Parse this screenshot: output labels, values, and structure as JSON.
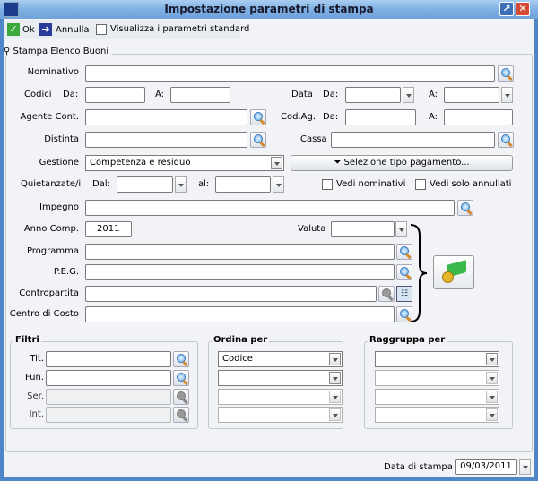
{
  "window": {
    "title": "Impostazione parametri di stampa"
  },
  "toolbar": {
    "ok": "Ok",
    "cancel": "Annulla",
    "standard": "Visualizza i parametri standard"
  },
  "group": {
    "title": "Stampa Elenco Buoni"
  },
  "labels": {
    "nominativo": "Nominativo",
    "codici": "Codici",
    "da": "Da:",
    "a": "A:",
    "data": "Data",
    "agente": "Agente Cont.",
    "codag": "Cod.Ag.",
    "distinta": "Distinta",
    "cassa": "Cassa",
    "gestione": "Gestione",
    "quietanzate": "Quietanzate/i",
    "dal": "Dal:",
    "al": "al:",
    "impegno": "Impegno",
    "anno": "Anno Comp.",
    "valuta": "Valuta",
    "programma": "Programma",
    "peg": "P.E.G.",
    "contropartita": "Contropartita",
    "centro": "Centro di Costo"
  },
  "values": {
    "gestione": "Competenza e residuo",
    "anno": "2011"
  },
  "buttons": {
    "tipo_pagamento": "Selezione tipo pagamento..."
  },
  "checks": {
    "vedi_nominativi": "Vedi nominativi",
    "vedi_annullati": "Vedi solo annullati"
  },
  "filtri": {
    "title": "Filtri",
    "rows": [
      "Tit.",
      "Fun.",
      "Ser.",
      "Int."
    ]
  },
  "ordina": {
    "title": "Ordina per",
    "first": "Codice"
  },
  "raggruppa": {
    "title": "Raggruppa per"
  },
  "footer": {
    "label": "Data di stampa",
    "date": "09/03/2011"
  }
}
